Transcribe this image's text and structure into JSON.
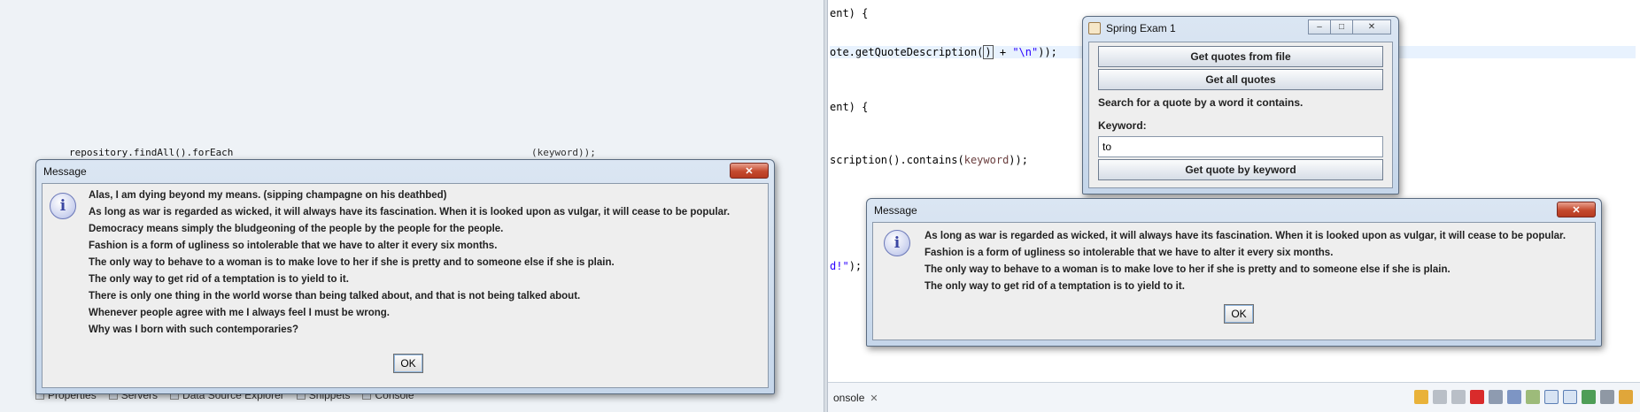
{
  "left_background": {
    "code_fragment": "repository.findAll().forEach",
    "code_fragment_right": "(keyword));",
    "bottom_tabs": [
      "Properties",
      "Servers",
      "Data Source Explorer",
      "Snippets",
      "Console"
    ]
  },
  "editor": {
    "lines": [
      {
        "pre": "ent) {",
        "str": "",
        "post": ""
      },
      {
        "pre": "ote.getQuoteDescription(",
        "cursor": ")",
        "mid": " + ",
        "str": "\"\\n\"",
        "post": "));"
      },
      {
        "pre": "ent) {",
        "str": "",
        "post": ""
      },
      {
        "pre": "scription().contains(",
        "var": "keyword",
        "post": "));"
      },
      {
        "pre": "",
        "str": "d!\"",
        "post": ");"
      }
    ],
    "console_tab": {
      "label": "onsole",
      "close": "✕"
    }
  },
  "app_window": {
    "title": "Spring Exam 1",
    "buttons": {
      "minimize": "–",
      "maximize": "□",
      "close": "✕"
    },
    "get_from_file": "Get quotes from file",
    "get_all": "Get all quotes",
    "search_hint": "Search for a quote by a word it contains.",
    "keyword_label": "Keyword:",
    "keyword_value": "to",
    "get_by_keyword": "Get quote by keyword"
  },
  "dialog_left": {
    "title": "Message",
    "close": "✕",
    "icon": "info-icon",
    "lines": [
      "Alas, I am dying beyond my means. (sipping champagne on his deathbed)",
      "As long as war is regarded as wicked, it will always have its fascination. When it is looked upon as vulgar, it will cease to be popular.",
      "Democracy means simply the bludgeoning of the people by the people for the people.",
      "Fashion is a form of ugliness so intolerable that we have to alter it every six months.",
      "The only way to behave to a woman is to make love to her if she is pretty and to someone else if she is plain.",
      "The only way to get rid of a temptation is to yield to it.",
      "There is only one thing in the world worse than being talked about, and that is not being talked about.",
      "Whenever people agree with me I always feel I must be wrong.",
      "Why was I born with such contemporaries?"
    ],
    "ok": "OK"
  },
  "dialog_right": {
    "title": "Message",
    "close": "✕",
    "icon": "info-icon",
    "lines": [
      "As long as war is regarded as wicked, it will always have its fascination. When it is looked upon as vulgar, it will cease to be popular.",
      "Fashion is a form of ugliness so intolerable that we have to alter it every six months.",
      "The only way to behave to a woman is to make love to her if she is pretty and to someone else if she is plain.",
      "The only way to get rid of a temptation is to yield to it."
    ],
    "ok": "OK"
  },
  "colors": {
    "close_button": "#c44a2e",
    "string_literal": "#2a00ff",
    "local_variable": "#6a3e3e",
    "highlight_line": "#e8f2fe"
  }
}
